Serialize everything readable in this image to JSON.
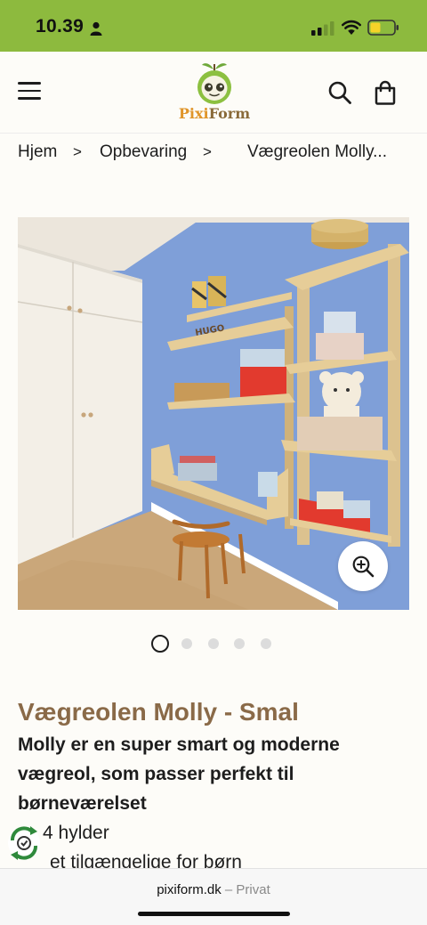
{
  "status_bar": {
    "time": "10.39"
  },
  "header": {
    "logo_part1": "Pixi",
    "logo_part2": "Form"
  },
  "breadcrumb": {
    "items": [
      "Hjem",
      "Opbevaring",
      "Vægreolen Molly..."
    ],
    "separator": ">"
  },
  "gallery": {
    "slide_count": 5,
    "active_index": 0
  },
  "product": {
    "title": "Vægreolen Molly - Smal",
    "description": "Molly er en super smart og moderne vægreol, som passer perfekt til børneværelset",
    "features": [
      "4 hylder",
      "et tilgængelige for børn"
    ]
  },
  "browser": {
    "domain": "pixiform.dk",
    "suffix": " – Privat"
  },
  "colors": {
    "status_bar": "#8dba3e",
    "title": "#8a6a48",
    "wall": "#7f9fd8"
  }
}
